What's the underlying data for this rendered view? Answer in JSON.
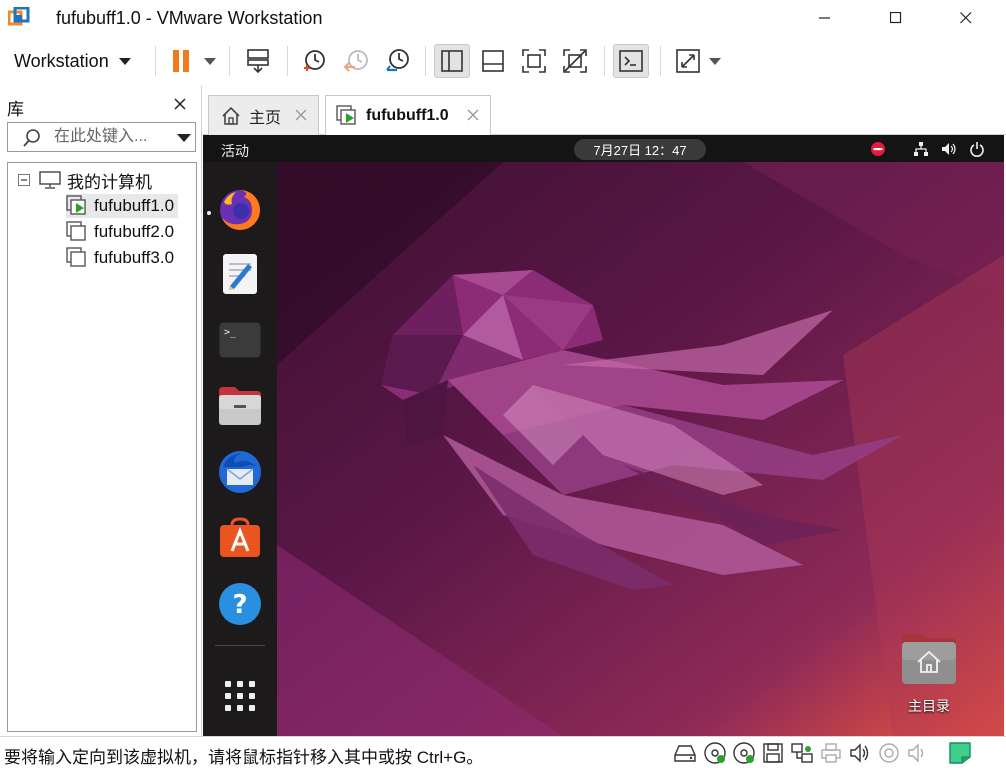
{
  "window": {
    "title": "fufubuff1.0 - VMware Workstation",
    "controls": [
      "minimize-icon",
      "maximize-icon",
      "close-icon"
    ]
  },
  "toolbar": {
    "menu_label": "Workstation",
    "buttons": [
      "pause-icon",
      "send-ctrl-alt-del-icon",
      "snapshot-take-icon",
      "snapshot-revert-icon",
      "snapshot-manager-icon",
      "view-library-icon",
      "view-thumbnail-icon",
      "fullscreen-icon",
      "unity-icon",
      "console-view-icon",
      "stretch-icon"
    ],
    "accent_color": "#f07b1c"
  },
  "library": {
    "title": "库",
    "search_placeholder": "在此处键入...",
    "tree": {
      "root_label": "我的计算机",
      "vms": [
        {
          "name": "fufubuff1.0",
          "running": true
        },
        {
          "name": "fufubuff2.0",
          "running": false
        },
        {
          "name": "fufubuff3.0",
          "running": false
        }
      ]
    }
  },
  "tabs": [
    {
      "label": "主页",
      "icon": "home-icon",
      "active": false
    },
    {
      "label": "fufubuff1.0",
      "icon": "vm-running-icon",
      "active": true
    }
  ],
  "guest": {
    "activities": "活动",
    "clock": "7月27日  12：47",
    "tray": [
      "do-not-disturb-icon",
      "network-icon",
      "volume-icon",
      "power-icon"
    ],
    "dock": [
      "firefox-icon",
      "text-editor-icon",
      "terminal-icon",
      "files-icon",
      "thunderbird-icon",
      "app-center-icon",
      "help-icon",
      "show-apps-icon"
    ],
    "desktop_home_label": "主目录",
    "wallpaper_colors": [
      "#3a0f2e",
      "#77215e",
      "#e9553f"
    ]
  },
  "statusbar": {
    "text": "要将输入定向到该虚拟机，请将鼠标指针移入其中或按 Ctrl+G。",
    "devices": [
      "hard-disk-icon",
      "cd-dvd-icon",
      "cd-dvd-2-icon",
      "floppy-icon",
      "network-adapter-icon",
      "printer-icon",
      "sound-icon",
      "usb-icon",
      "display-icon",
      "message-icon"
    ]
  }
}
